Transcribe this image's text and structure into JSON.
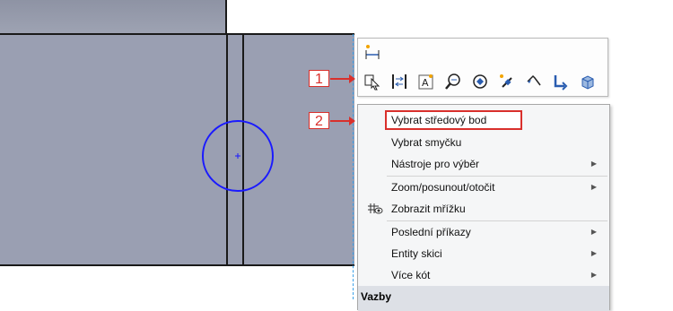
{
  "callouts": [
    "1",
    "2"
  ],
  "toolbar": {
    "top_icon": "smart-dimension-icon",
    "icons": [
      "select-icon",
      "sketch-relations-icon",
      "sketch-text-icon",
      "zoom-to-fit-icon",
      "rotate-view-icon",
      "smart-dimension-add-icon",
      "undo-edit-icon",
      "previous-view-icon",
      "section-view-icon"
    ]
  },
  "menu": {
    "items": [
      {
        "label": "Vybrat středový bod",
        "submenu": false
      },
      {
        "label": "Vybrat smyčku",
        "submenu": false
      },
      {
        "label": "Nástroje pro výběr",
        "submenu": true
      },
      {
        "label": "Zoom/posunout/otočit",
        "submenu": true
      },
      {
        "label": "Zobrazit mřížku",
        "submenu": false
      },
      {
        "label": "Poslední příkazy",
        "submenu": true
      },
      {
        "label": "Entity skici",
        "submenu": true
      },
      {
        "label": "Více kót",
        "submenu": true
      }
    ],
    "header": "Vazby",
    "submenu_glyph": "▶"
  },
  "colors": {
    "accent": "#d9302c",
    "circle": "#1a1aff",
    "model": "#9a9fb2"
  }
}
